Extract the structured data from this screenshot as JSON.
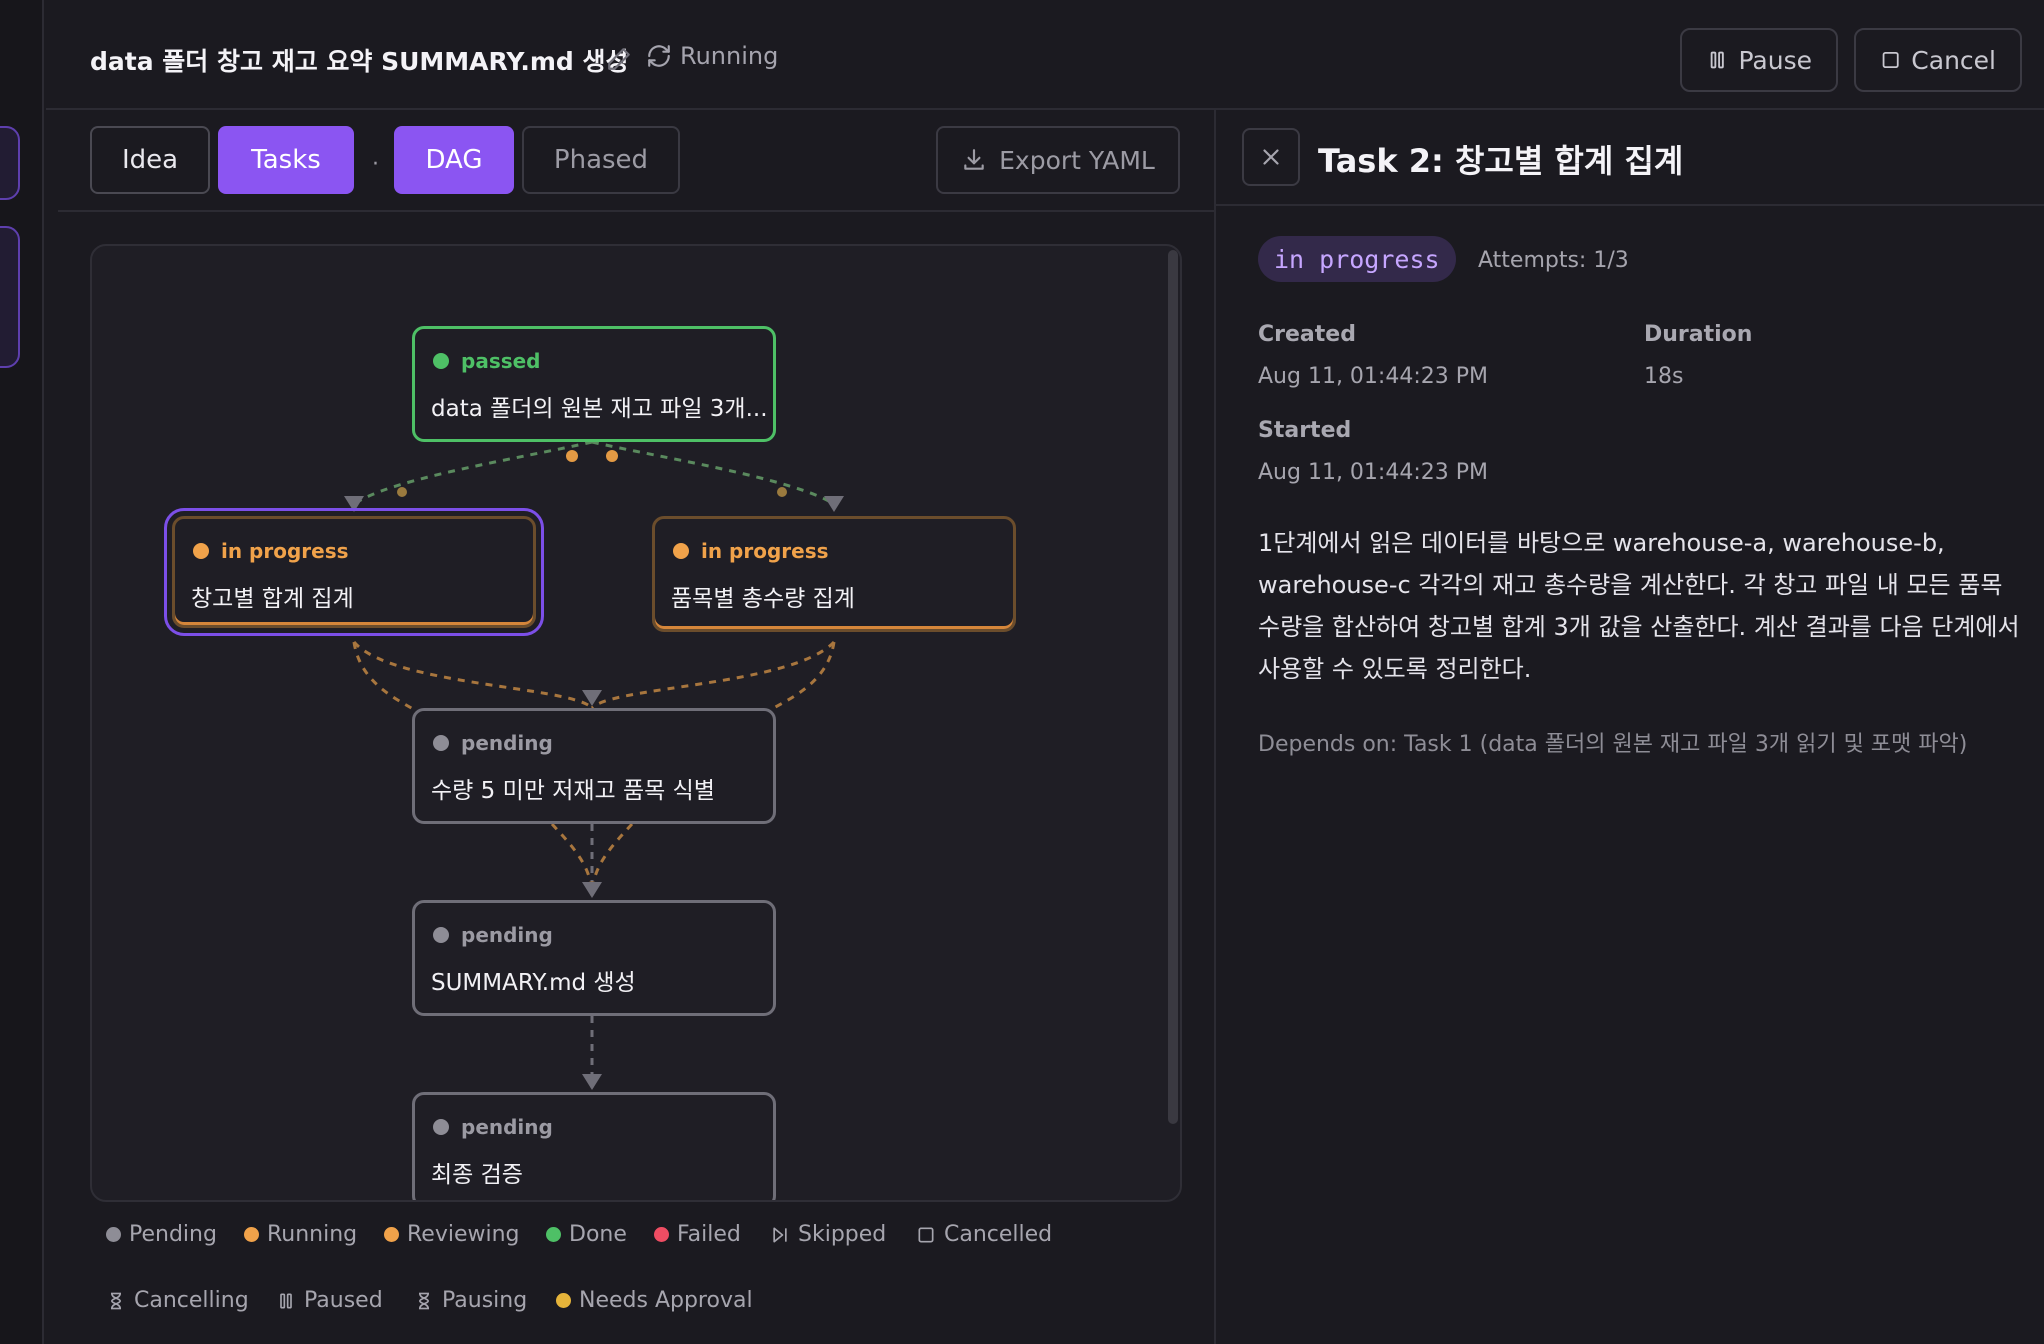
{
  "header": {
    "title": "data 폴더 창고 재고 요약 SUMMARY.md 생성",
    "status": "Running",
    "pause_label": "Pause",
    "cancel_label": "Cancel"
  },
  "toolbar": {
    "tabs": [
      {
        "label": "Idea",
        "active": false
      },
      {
        "label": "Tasks",
        "active": true
      },
      {
        "label": "DAG",
        "active": true
      },
      {
        "label": "Phased",
        "active": false
      }
    ],
    "separator": "·",
    "export_label": "Export YAML"
  },
  "dag": {
    "nodes": [
      {
        "id": "t1",
        "status": "passed",
        "label": "data 폴더의 원본 재고 파일 3개..."
      },
      {
        "id": "t2",
        "status": "in progress",
        "label": "창고별 합계 집계",
        "selected": true
      },
      {
        "id": "t3",
        "status": "in progress",
        "label": "품목별 총수량 집계"
      },
      {
        "id": "t4",
        "status": "pending",
        "label": "수량 5 미만 저재고 품목 식별"
      },
      {
        "id": "t5",
        "status": "pending",
        "label": "SUMMARY.md 생성"
      },
      {
        "id": "t6",
        "status": "pending",
        "label": "최종 검증"
      }
    ],
    "edges": [
      [
        "t1",
        "t2"
      ],
      [
        "t1",
        "t3"
      ],
      [
        "t2",
        "t4"
      ],
      [
        "t3",
        "t4"
      ],
      [
        "t4",
        "t5"
      ],
      [
        "t5",
        "t6"
      ]
    ]
  },
  "legend": [
    {
      "label": "Pending",
      "icon": "dot",
      "color": "#8e8d96"
    },
    {
      "label": "Running",
      "icon": "dot",
      "color": "#f0a24a"
    },
    {
      "label": "Reviewing",
      "icon": "dot",
      "color": "#f0a24a"
    },
    {
      "label": "Done",
      "icon": "dot",
      "color": "#4ec066"
    },
    {
      "label": "Failed",
      "icon": "dot",
      "color": "#ef4d63"
    },
    {
      "label": "Skipped",
      "icon": "skip-icon"
    },
    {
      "label": "Cancelled",
      "icon": "square-icon"
    },
    {
      "label": "Cancelling",
      "icon": "hourglass-icon"
    },
    {
      "label": "Paused",
      "icon": "pause-icon"
    },
    {
      "label": "Pausing",
      "icon": "hourglass-icon"
    },
    {
      "label": "Needs Approval",
      "icon": "dot",
      "color": "#e6b43a"
    }
  ],
  "panel": {
    "title": "Task 2: 창고별 합계 집계",
    "badge": "in progress",
    "attempts": "Attempts: 1/3",
    "created_label": "Created",
    "created_value": "Aug 11, 01:44:23 PM",
    "duration_label": "Duration",
    "duration_value": "18s",
    "started_label": "Started",
    "started_value": "Aug 11, 01:44:23 PM",
    "description": "1단계에서 읽은 데이터를 바탕으로 warehouse-a, warehouse-b, warehouse-c 각각의 재고 총수량을 계산한다. 각 창고 파일 내 모든 품목 수량을 합산하여 창고별 합계 3개 값을 산출한다. 계산 결과를 다음 단계에서 사용할 수 있도록 정리한다.",
    "depends_on": "Depends on: Task 1 (data 폴더의 원본 재고 파일 3개 읽기 및 포맷 파악)"
  },
  "colors": {
    "accent": "#8b55f2",
    "passed": "#4ec066",
    "running": "#f0a24a",
    "pending": "#8e8d96",
    "failed": "#ef4d63"
  }
}
